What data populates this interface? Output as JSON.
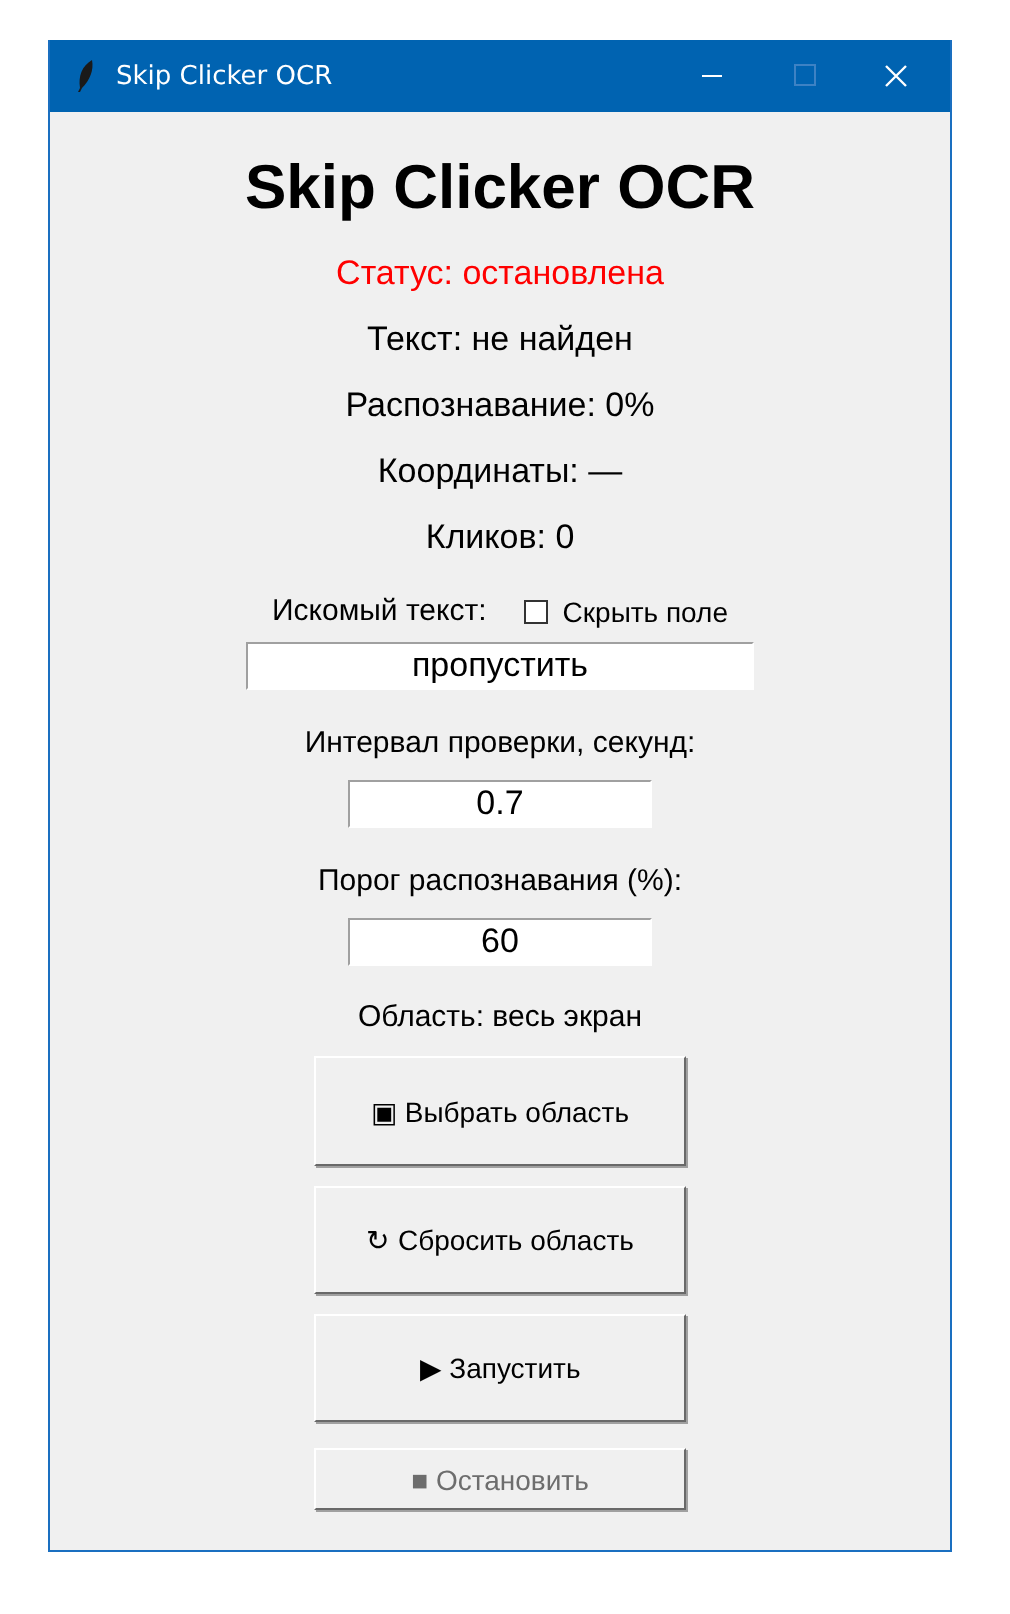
{
  "window": {
    "title": "Skip Clicker OCR"
  },
  "heading": "Skip Clicker OCR",
  "status_lines": [
    {
      "kind": "alert",
      "text": "Статус: остановлена"
    },
    {
      "kind": "info",
      "text": "Текст: не найден"
    },
    {
      "kind": "info",
      "text": "Распознавание: 0%"
    },
    {
      "kind": "info",
      "text": "Координаты: —"
    },
    {
      "kind": "info",
      "text": "Кликов: 0"
    }
  ],
  "search_text": {
    "label": "Искомый текст:",
    "hide_checkbox": {
      "label": "Скрыть поле",
      "checked": false
    },
    "value": "пропустить"
  },
  "interval": {
    "label": "Интервал проверки, секунд:",
    "value": "0.7"
  },
  "threshold": {
    "label": "Порог распознавания (%):",
    "value": "60"
  },
  "area_label": "Область: весь экран",
  "buttons": [
    {
      "icon": "▣",
      "label": "Выбрать область",
      "disabled": false,
      "kind": "tall"
    },
    {
      "icon": "↻",
      "label": "Сбросить область",
      "disabled": false,
      "kind": "tall"
    },
    {
      "icon": "▶",
      "label": "Запустить",
      "disabled": false,
      "kind": "tall"
    },
    {
      "icon": "■",
      "label": "Остановить",
      "disabled": true,
      "kind": "compact"
    }
  ]
}
